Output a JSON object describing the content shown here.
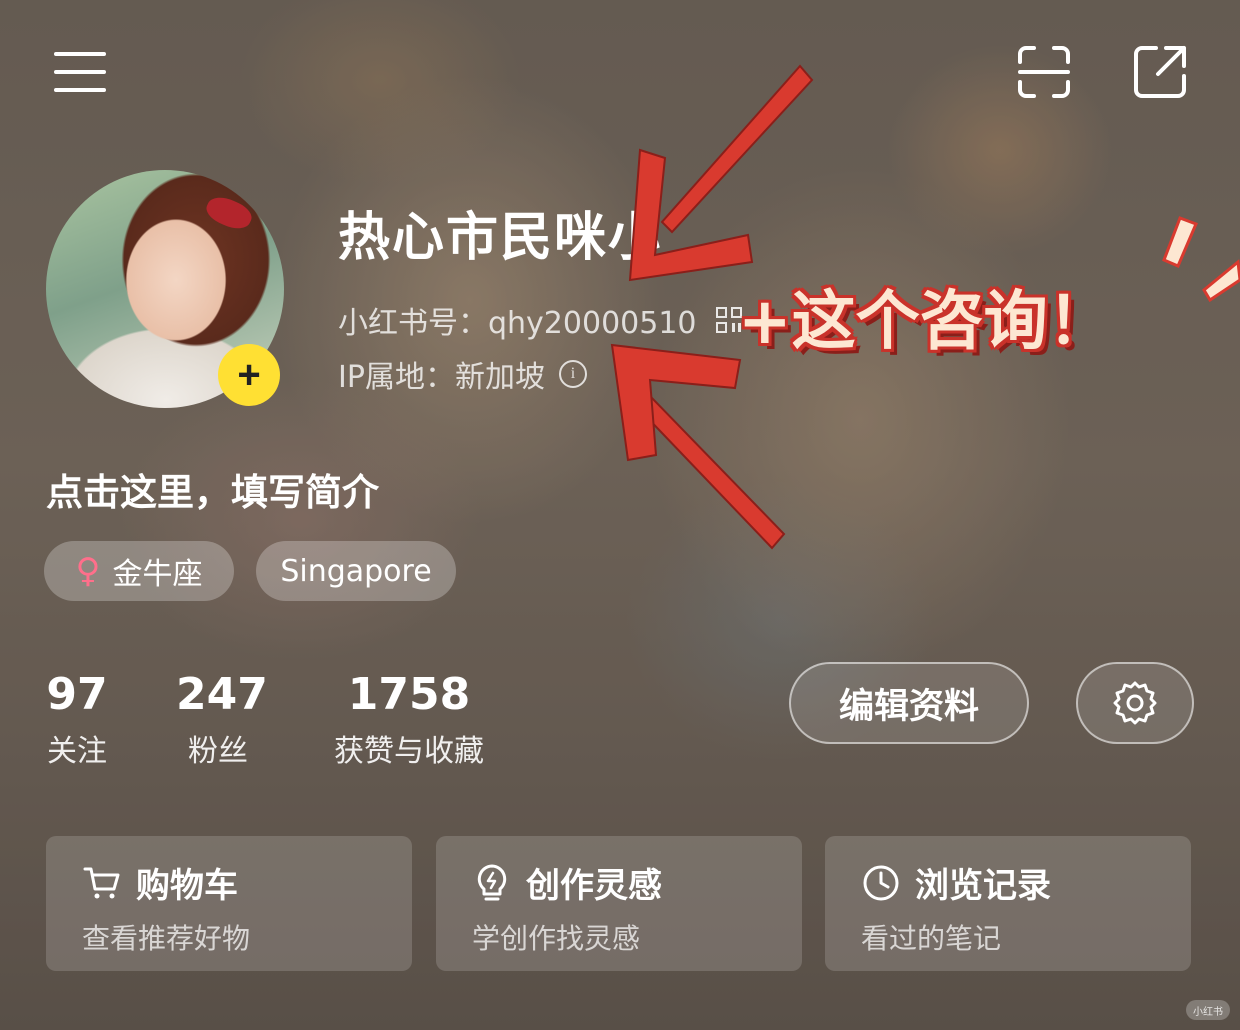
{
  "profile": {
    "nickname": "热心市民咪小",
    "red_id": "小红书号：qhy20000510",
    "ip_location": "IP属地：新加坡",
    "bio": "点击这里，填写简介",
    "tags": {
      "zodiac": "金牛座",
      "city": "Singapore"
    }
  },
  "stats": [
    {
      "value": "97",
      "label": "关注"
    },
    {
      "value": "247",
      "label": "粉丝"
    },
    {
      "value": "1758",
      "label": "获赞与收藏"
    }
  ],
  "actions": {
    "edit_label": "编辑资料"
  },
  "cards": [
    {
      "title": "购物车",
      "subtitle": "查看推荐好物",
      "icon": "cart-icon"
    },
    {
      "title": "创作灵感",
      "subtitle": "学创作找灵感",
      "icon": "lightbulb-icon"
    },
    {
      "title": "浏览记录",
      "subtitle": "看过的笔记",
      "icon": "clock-icon"
    }
  ],
  "annotation": {
    "text": "+这个咨询！",
    "color": "#d93a2f"
  },
  "icons": {
    "menu": "hamburger-menu-icon",
    "scan": "scan-icon",
    "share": "share-icon",
    "qr": "qr-code-icon",
    "info": "info-icon",
    "settings": "gear-icon",
    "add": "plus-icon",
    "gender": "female-icon"
  },
  "colors": {
    "badge": "#ffe033",
    "female": "#ff6f8b",
    "arrow": "#d93a2f"
  }
}
